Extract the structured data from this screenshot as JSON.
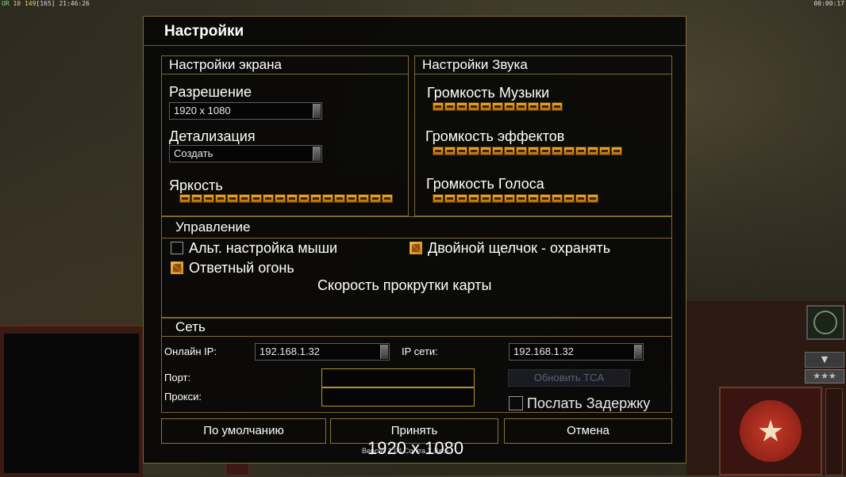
{
  "hud": {
    "tl_prefix": "UR",
    "tl_a": "10",
    "tl_b": "149",
    "tl_c": "[165]",
    "tl_time": "21:46:26",
    "tr_time": "00:00:17",
    "stars": "★★★",
    "down_arrow": "▼",
    "emblem_star": "★"
  },
  "dialog": {
    "title": "Настройки",
    "screen": {
      "header": "Настройки экрана",
      "resolution_label": "Разрешение",
      "resolution_value": "1920 x 1080",
      "detail_label": "Детализация",
      "detail_value": "Создать",
      "brightness_label": "Яркость",
      "brightness_level": 18
    },
    "sound": {
      "header": "Настройки Звука",
      "music_label": "Громкость Музыки",
      "music_level": 11,
      "effects_label": "Громкость эффектов",
      "effects_level": 16,
      "voice_label": "Громкость Голоса",
      "voice_level": 14
    },
    "controls": {
      "header": "Управление",
      "alt_mouse_label": "Альт. настройка мыши",
      "alt_mouse_checked": false,
      "double_click_label": "Двойной щелчок - охранять",
      "double_click_checked": true,
      "return_fire_label": "Ответный огонь",
      "return_fire_checked": true,
      "scroll_speed_label": "Скорость прокрутки карты"
    },
    "network": {
      "header": "Сеть",
      "online_ip_label": "Онлайн IP:",
      "online_ip_value": "192.168.1.32",
      "lan_ip_label": "IP сети:",
      "lan_ip_value": "192.168.1.32",
      "port_label": "Порт:",
      "port_value": "",
      "proxy_label": "Прокси:",
      "proxy_value": "",
      "update_tca_label": "Обновить TCA",
      "send_delay_label": "Послать Задержку",
      "send_delay_checked": false
    },
    "buttons": {
      "defaults": "По умолчанию",
      "accept": "Принять",
      "cancel": "Отмена"
    },
    "version_text": "Версия 1.04 Contra X Beta"
  },
  "overlay_resolution": "1920 x 1080",
  "colors": {
    "accent_gold": "#b99428",
    "slider_orange": "#f0a928",
    "panel_border": "#7a6a36"
  }
}
